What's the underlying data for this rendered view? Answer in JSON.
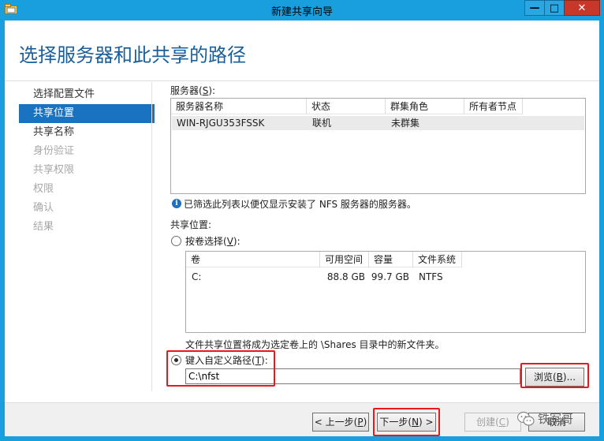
{
  "window": {
    "title": "新建共享向导",
    "controls": {
      "minimize": "—",
      "maximize": "□",
      "close": "✕"
    }
  },
  "heading": "选择服务器和此共享的路径",
  "nav": {
    "items": [
      {
        "label": "选择配置文件",
        "state": "normal"
      },
      {
        "label": "共享位置",
        "state": "active"
      },
      {
        "label": "共享名称",
        "state": "normal"
      },
      {
        "label": "身份验证",
        "state": "disabled"
      },
      {
        "label": "共享权限",
        "state": "disabled"
      },
      {
        "label": "权限",
        "state": "disabled"
      },
      {
        "label": "确认",
        "state": "disabled"
      },
      {
        "label": "结果",
        "state": "disabled"
      }
    ]
  },
  "server_section": {
    "label_prefix": "服务器(",
    "label_key": "S",
    "label_suffix": "):",
    "columns": [
      "服务器名称",
      "状态",
      "群集角色",
      "所有者节点"
    ],
    "rows": [
      {
        "name": "WIN-RJGU353FSSK",
        "status": "联机",
        "cluster_role": "未群集",
        "owner_node": ""
      }
    ]
  },
  "info": {
    "icon_glyph": "i",
    "text": "已筛选此列表以便仅显示安装了 NFS 服务器的服务器。"
  },
  "share_location": {
    "label": "共享位置:",
    "by_volume": {
      "label_prefix": "按卷选择(",
      "label_key": "V",
      "label_suffix": "):",
      "checked": false
    },
    "volume_columns": [
      "卷",
      "可用空间",
      "容量",
      "文件系统"
    ],
    "volumes": [
      {
        "volume": "C:",
        "free": "88.8 GB",
        "capacity": "99.7 GB",
        "fs": "NTFS"
      }
    ],
    "volume_note": "文件共享位置将成为选定卷上的 \\Shares 目录中的新文件夹。",
    "custom_path": {
      "label_prefix": "键入自定义路径(",
      "label_key": "T",
      "label_suffix": "):",
      "checked": true,
      "value": "C:\\nfst"
    },
    "browse_button": {
      "prefix": "浏览(",
      "key": "B",
      "suffix": ")..."
    }
  },
  "footer": {
    "prev": {
      "prefix": "< 上一步(",
      "key": "P",
      "suffix": ")"
    },
    "next": {
      "prefix": "下一步(",
      "key": "N",
      "suffix": ") >"
    },
    "create": {
      "prefix": "创建(",
      "key": "C",
      "suffix": ")"
    },
    "cancel": "取消"
  },
  "watermark": "铁军哥",
  "colors": {
    "title_bar": "#1a9fde",
    "accent": "#1a73c1",
    "highlight_box": "#e8191a"
  }
}
